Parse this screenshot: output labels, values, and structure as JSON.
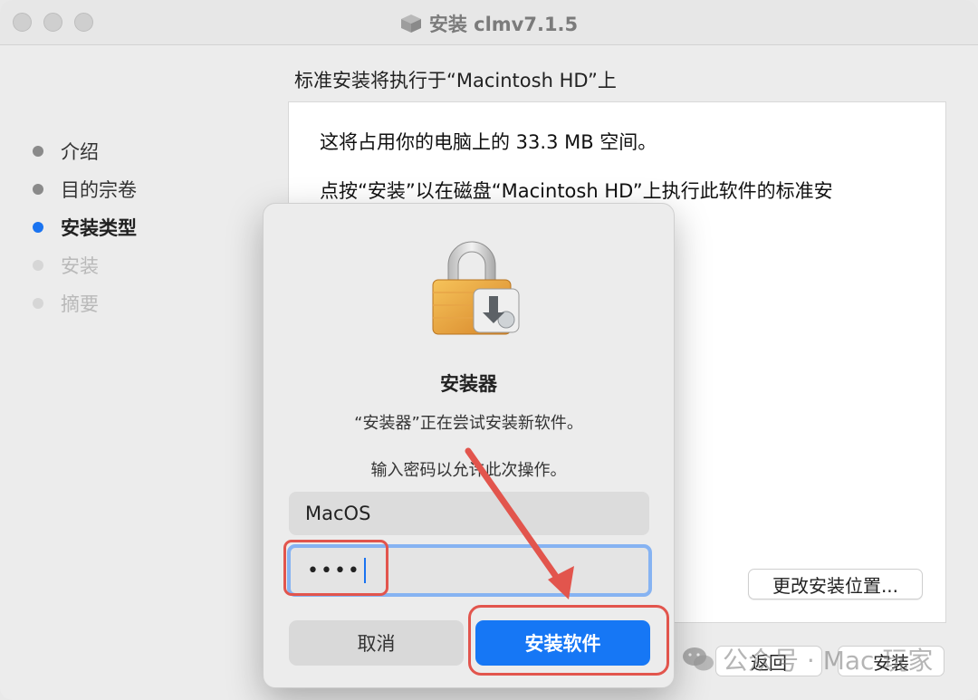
{
  "window": {
    "title": "安装 clmv7.1.5"
  },
  "heading": "标准安装将执行于“Macintosh HD”上",
  "sidebar": {
    "steps": [
      {
        "label": "介绍",
        "state": "done"
      },
      {
        "label": "目的宗卷",
        "state": "done"
      },
      {
        "label": "安装类型",
        "state": "active"
      },
      {
        "label": "安装",
        "state": "pending"
      },
      {
        "label": "摘要",
        "state": "pending"
      }
    ]
  },
  "content": {
    "line1": "这将占用你的电脑上的 33.3 MB 空间。",
    "line2": "点按“安装”以在磁盘“Macintosh HD”上执行此软件的标准安"
  },
  "buttons": {
    "change_location": "更改安装位置...",
    "back": "返回",
    "install": "安装"
  },
  "dialog": {
    "title": "安装器",
    "message": "“安装器”正在尝试安装新软件。",
    "prompt": "输入密码以允许此次操作。",
    "username": "MacOS",
    "password_mask": "••••",
    "cancel_label": "取消",
    "confirm_label": "安装软件"
  },
  "watermark": "公众号 · Mac 玩家",
  "colors": {
    "accent": "#1677f5",
    "highlight": "#e2554d",
    "focus_ring": "#86b3f2"
  },
  "icons": {
    "window": "package-icon",
    "dialog": "lock-icon",
    "watermark": "wechat-icon"
  }
}
